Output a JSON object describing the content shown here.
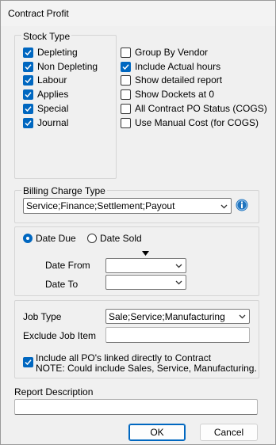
{
  "window": {
    "title": "Contract Profit"
  },
  "stock_type": {
    "legend": "Stock Type",
    "items": [
      {
        "label": "Depleting",
        "checked": true
      },
      {
        "label": "Non Depleting",
        "checked": true
      },
      {
        "label": "Labour",
        "checked": true
      },
      {
        "label": "Applies",
        "checked": true
      },
      {
        "label": "Special",
        "checked": true
      },
      {
        "label": "Journal",
        "checked": true
      }
    ]
  },
  "options": [
    {
      "label": "Group By Vendor",
      "checked": false
    },
    {
      "label": "Include Actual hours",
      "checked": true
    },
    {
      "label": "Show detailed report",
      "checked": false
    },
    {
      "label": "Show Dockets at 0",
      "checked": false
    },
    {
      "label": "All Contract PO Status (COGS)",
      "checked": false
    },
    {
      "label": "Use Manual Cost (for COGS)",
      "checked": false
    }
  ],
  "billing": {
    "legend": "Billing Charge Type",
    "value": "Service;Finance;Settlement;Payout"
  },
  "dates": {
    "radio_due": "Date Due",
    "radio_sold": "Date Sold",
    "selected": "Date Due",
    "from_label": "Date From",
    "to_label": "Date To",
    "from_value": "",
    "to_value": ""
  },
  "job": {
    "type_label": "Job Type",
    "type_value": "Sale;Service;Manufacturing",
    "exclude_label": "Exclude Job Item",
    "exclude_value": "",
    "include_po_line1": "Include all PO's linked directly to Contract",
    "include_po_line2": "NOTE: Could include Sales, Service, Manufacturing.",
    "include_po_checked": true
  },
  "report": {
    "label": "Report Description",
    "value": ""
  },
  "buttons": {
    "ok": "OK",
    "cancel": "Cancel"
  },
  "colors": {
    "accent": "#0067c0",
    "info_icon": "#1e73be"
  }
}
